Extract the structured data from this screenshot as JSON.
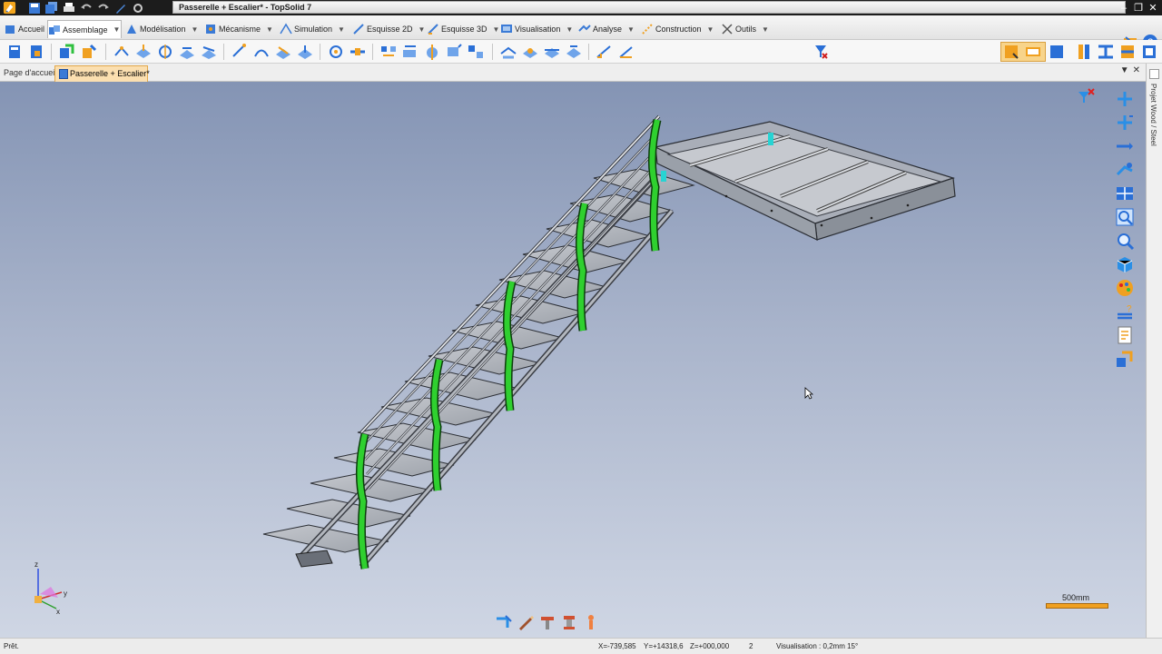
{
  "window": {
    "title": "Passerelle + Escalier* - TopSolid 7"
  },
  "ribbon": {
    "tabs": [
      {
        "label": "Accueil",
        "icon": "home-icon"
      },
      {
        "label": "Assemblage",
        "icon": "assembly-icon",
        "active": true
      },
      {
        "label": "Modélisation",
        "icon": "modeling-icon"
      },
      {
        "label": "Mécanisme",
        "icon": "mechanism-icon"
      },
      {
        "label": "Simulation",
        "icon": "simulation-icon"
      },
      {
        "label": "Esquisse 2D",
        "icon": "sketch-2d-icon"
      },
      {
        "label": "Esquisse 3D",
        "icon": "sketch-3d-icon"
      },
      {
        "label": "Visualisation",
        "icon": "visualisation-icon"
      },
      {
        "label": "Analyse",
        "icon": "analysis-icon"
      },
      {
        "label": "Construction",
        "icon": "construction-icon"
      },
      {
        "label": "Outils",
        "icon": "tools-icon"
      }
    ]
  },
  "documents": {
    "home": "Page d'accueil",
    "active": "Passerelle + Escalier*"
  },
  "side_panel": {
    "label": "Projet Wood / Steel"
  },
  "scale": {
    "label": "500mm"
  },
  "status": {
    "ready": "Prêt.",
    "x": "X=-739,585",
    "y": "Y=+14318,6",
    "z": "Z=+000,000",
    "count": "2",
    "visualisation": "Visualisation : 0,2mm 15°"
  },
  "triad": {
    "x": "x",
    "y": "y",
    "z": "z"
  },
  "colors": {
    "accent_orange": "#f0a020",
    "posts_green": "#2fd02f",
    "steel": "#c8c8c8",
    "tool_blue": "#2a6fd6"
  }
}
